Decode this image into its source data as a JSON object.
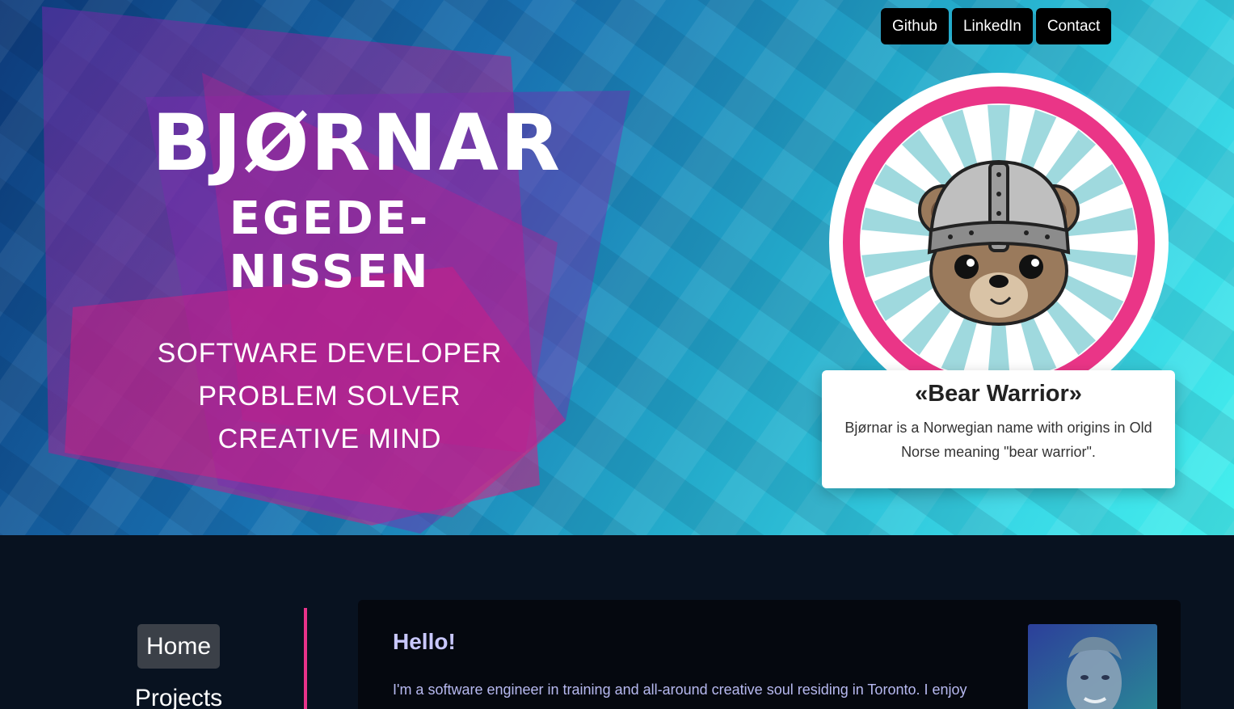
{
  "nav": {
    "links": [
      {
        "label": "Github"
      },
      {
        "label": "LinkedIn"
      },
      {
        "label": "Contact"
      }
    ]
  },
  "hero": {
    "first_name": "BJØRNAR",
    "last_name": "EGEDE-NISSEN",
    "taglines": [
      "SOFTWARE DEVELOPER",
      "PROBLEM SOLVER",
      "CREATIVE MIND"
    ]
  },
  "badge": {
    "icon": "viking-bear-icon",
    "title": "«Bear Warrior»",
    "description": "Bjørnar is a Norwegian name with origins in Old Norse meaning \"bear warrior\"."
  },
  "sidebar": {
    "items": [
      {
        "label": "Home",
        "active": true
      },
      {
        "label": "Projects",
        "active": false
      }
    ]
  },
  "intro": {
    "heading": "Hello!",
    "text": "I'm a software engineer in training and all-around creative soul residing in Toronto. I enjoy"
  },
  "colors": {
    "accent": "#e8338a",
    "hero_gradient_start": "#0d3a7a",
    "hero_gradient_end": "#45f0ee",
    "dark_bg": "#081220",
    "heading_color": "#c9c8ff"
  }
}
